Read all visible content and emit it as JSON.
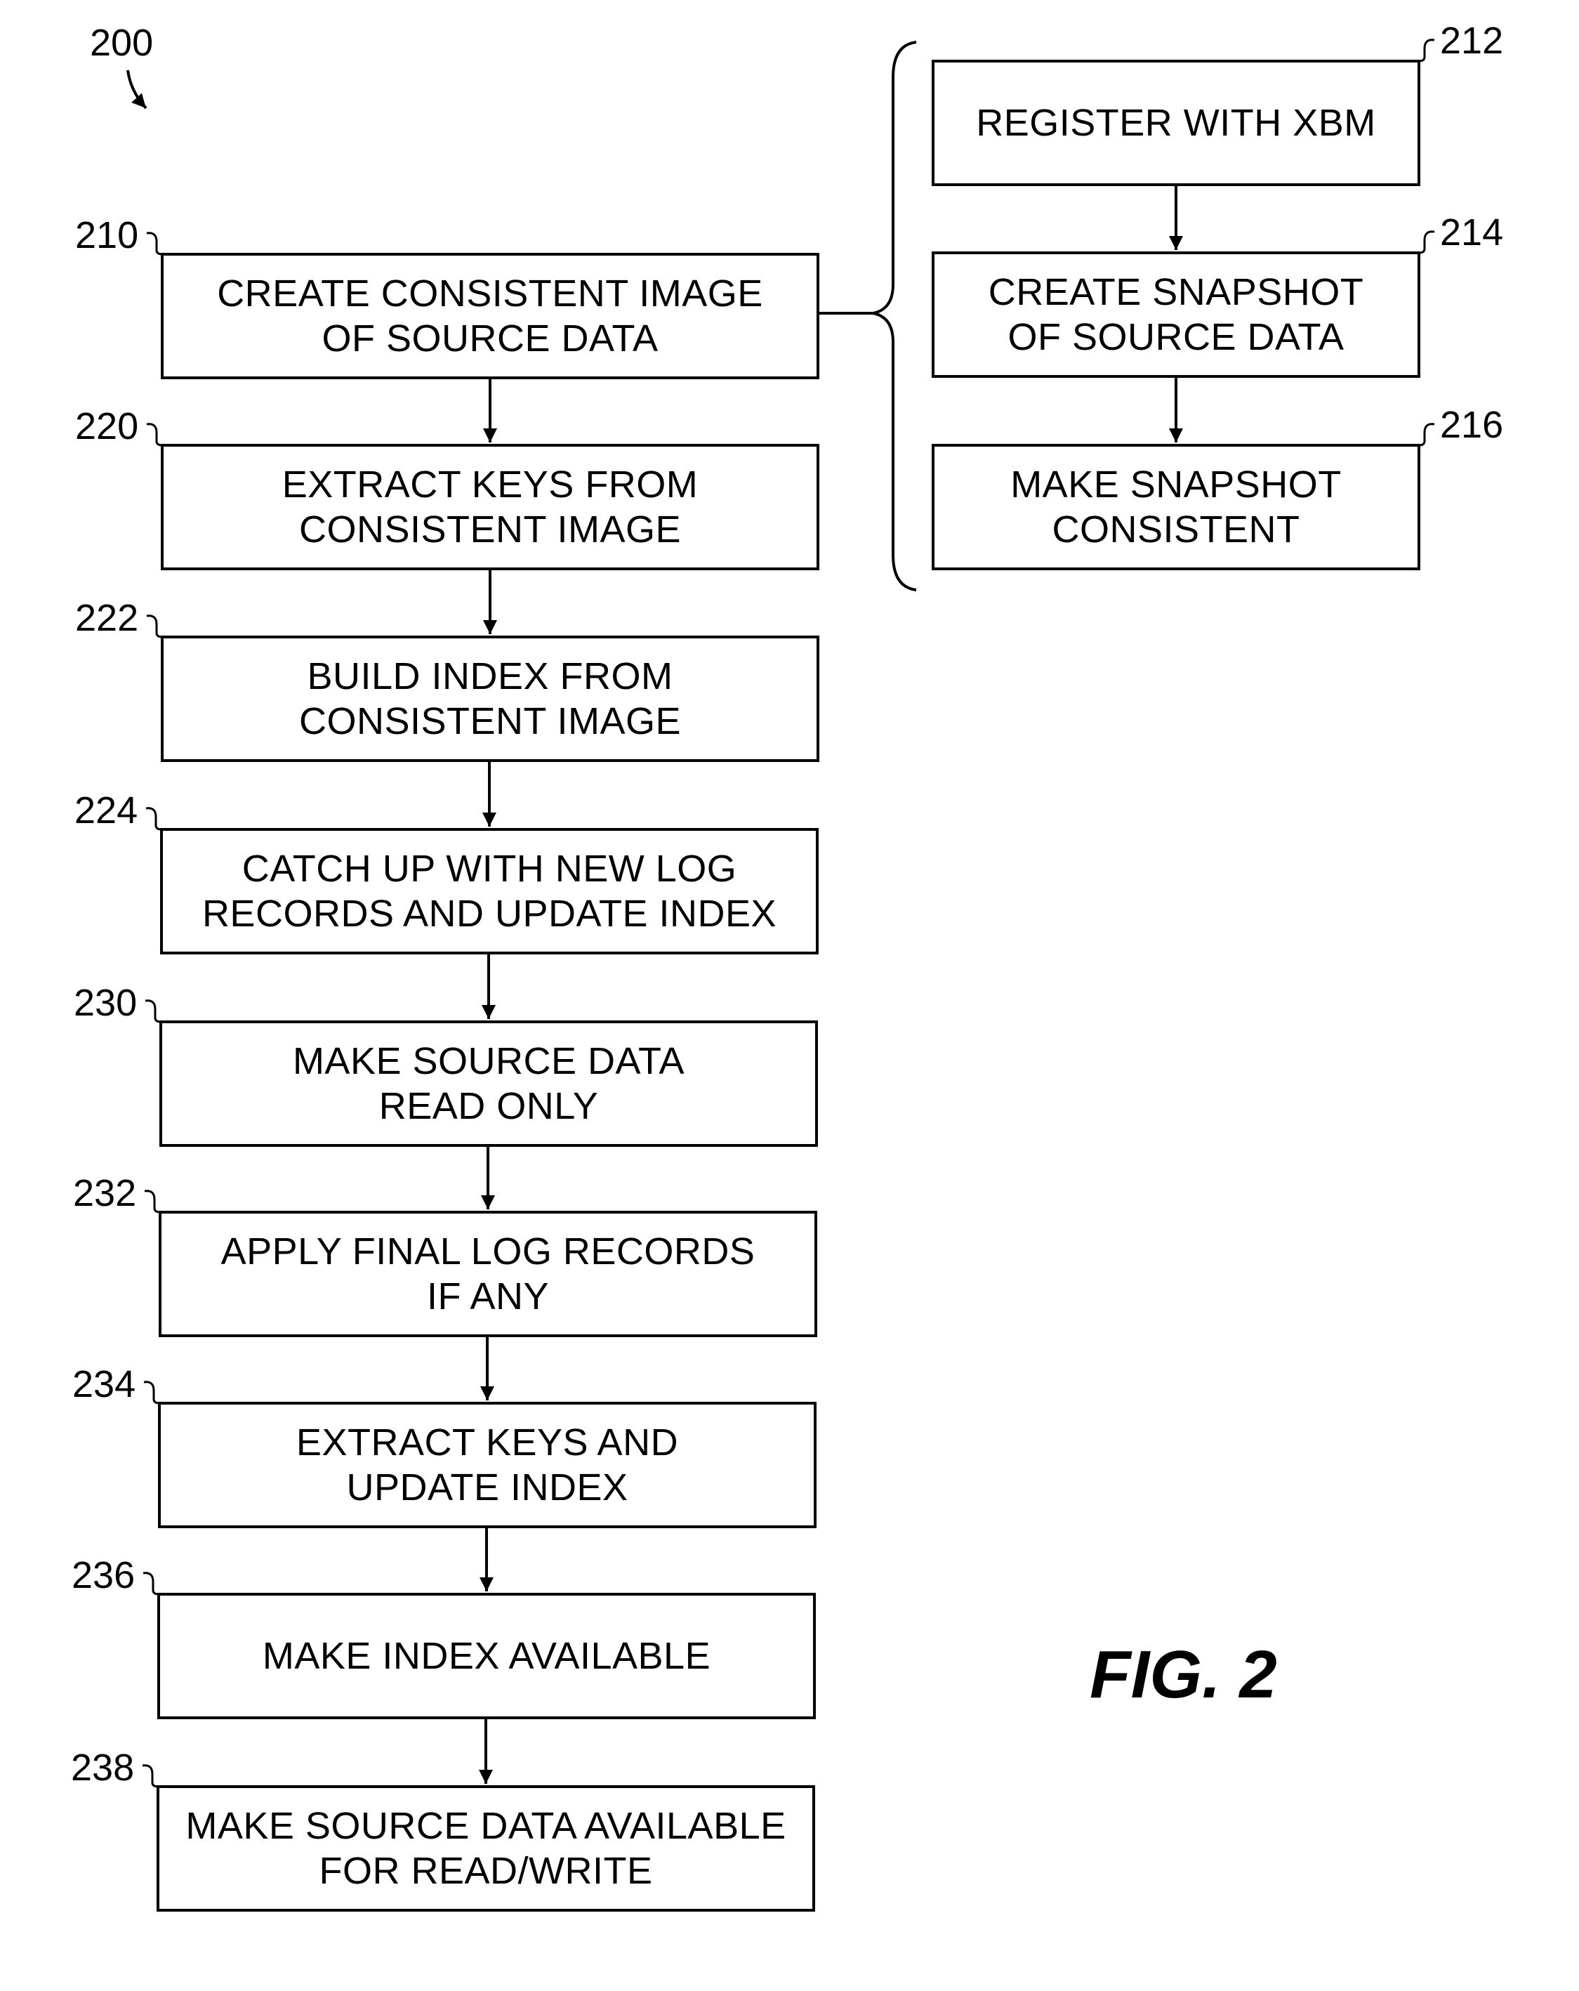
{
  "figure": {
    "number_ref": "200",
    "caption": "FIG. 2"
  },
  "steps": [
    {
      "ref": "210",
      "text": "CREATE CONSISTENT IMAGE\nOF SOURCE DATA"
    },
    {
      "ref": "220",
      "text": "EXTRACT KEYS FROM\nCONSISTENT IMAGE"
    },
    {
      "ref": "222",
      "text": "BUILD INDEX FROM\nCONSISTENT IMAGE"
    },
    {
      "ref": "224",
      "text": "CATCH UP WITH NEW LOG\nRECORDS AND UPDATE INDEX"
    },
    {
      "ref": "230",
      "text": "MAKE SOURCE DATA\nREAD ONLY"
    },
    {
      "ref": "232",
      "text": "APPLY FINAL LOG RECORDS\nIF ANY"
    },
    {
      "ref": "234",
      "text": "EXTRACT KEYS AND\nUPDATE INDEX"
    },
    {
      "ref": "236",
      "text": "MAKE INDEX AVAILABLE"
    },
    {
      "ref": "238",
      "text": "MAKE SOURCE DATA AVAILABLE\nFOR READ/WRITE"
    }
  ],
  "substeps": [
    {
      "ref": "212",
      "text": "REGISTER WITH XBM"
    },
    {
      "ref": "214",
      "text": "CREATE SNAPSHOT\nOF SOURCE DATA"
    },
    {
      "ref": "216",
      "text": "MAKE SNAPSHOT\nCONSISTENT"
    }
  ]
}
